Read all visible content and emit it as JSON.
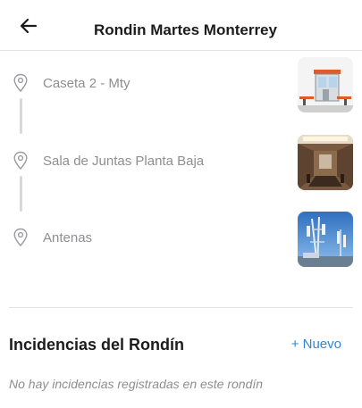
{
  "header": {
    "title": "Rondin Martes Monterrey",
    "back_icon": "arrow-left-icon"
  },
  "checkpoints": [
    {
      "label": "Caseta 2 - Mty",
      "icon": "map-pin-icon",
      "thumbnail": "guard-booth-photo"
    },
    {
      "label": "Sala de Juntas Planta Baja",
      "icon": "map-pin-icon",
      "thumbnail": "meeting-room-photo"
    },
    {
      "label": "Antenas",
      "icon": "map-pin-icon",
      "thumbnail": "antennas-photo"
    }
  ],
  "incidents": {
    "title": "Incidencias del Rondín",
    "new_label": "+ Nuevo",
    "empty_message": "No hay incidencias registradas en este rondín"
  },
  "colors": {
    "accent": "#2f86d8",
    "muted_text": "#8e8e93",
    "divider": "#e3e3e6"
  }
}
